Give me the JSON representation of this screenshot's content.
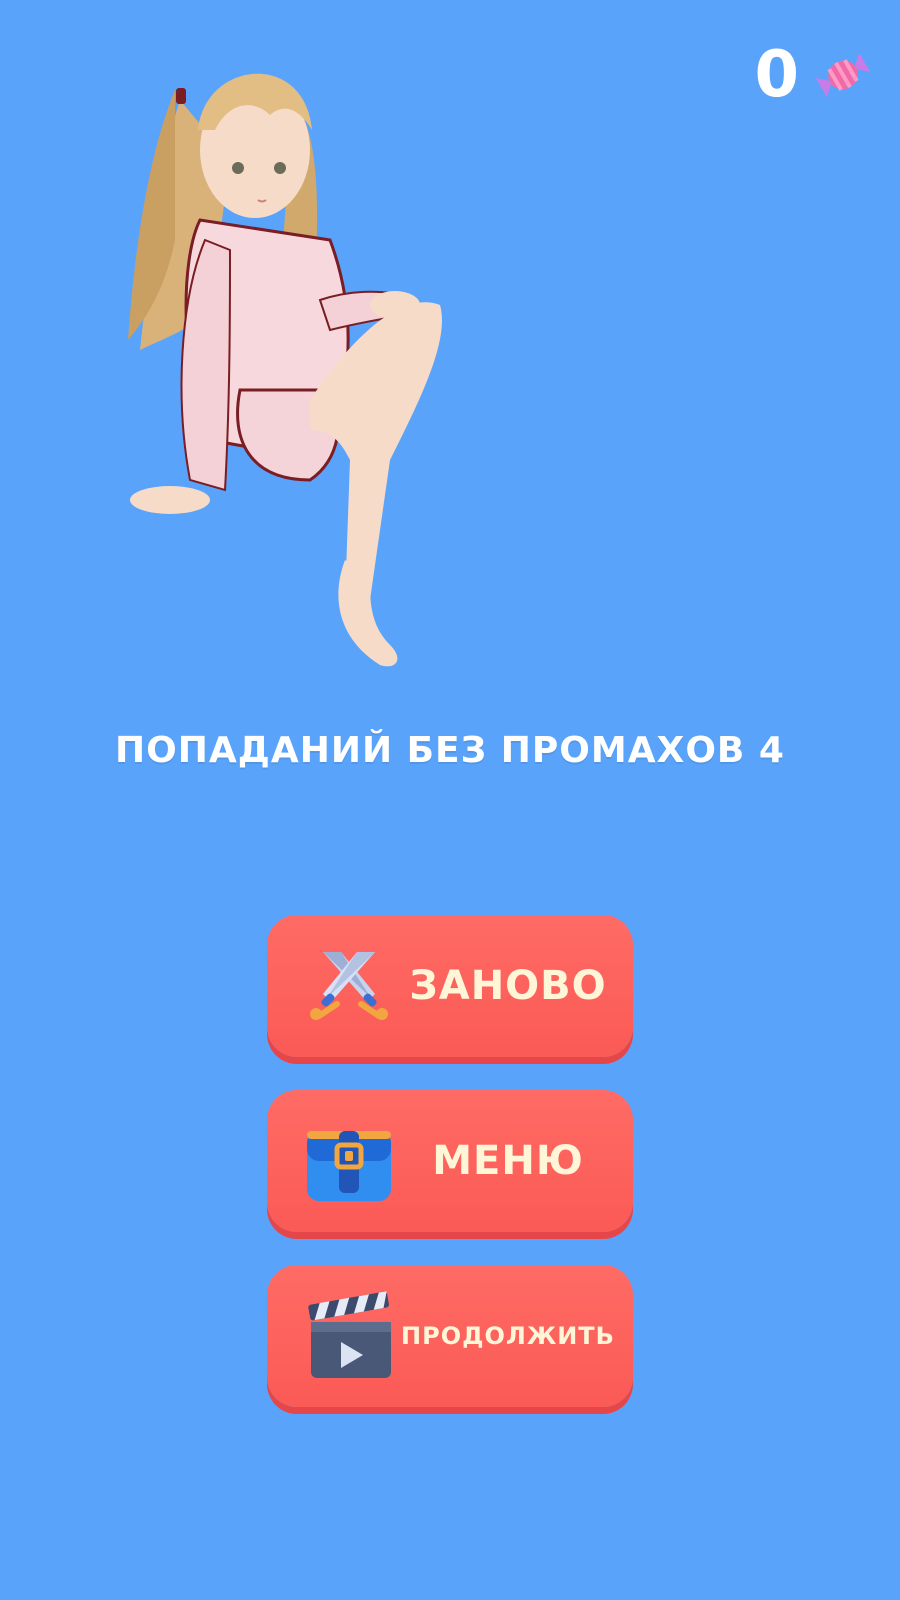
{
  "hud": {
    "score": "0",
    "currency_icon": "candy-icon"
  },
  "character": {
    "icon": "anime-girl-illustration"
  },
  "result": {
    "text": "ПОПАДАНИЙ БЕЗ ПРОМАХОВ 4"
  },
  "buttons": {
    "restart": {
      "label": "ЗАНОВО",
      "icon": "crossed-swords-icon"
    },
    "menu": {
      "label": "МЕНЮ",
      "icon": "backpack-icon"
    },
    "continue": {
      "label": "ПРОДОЛЖИТЬ",
      "icon": "clapperboard-play-icon"
    }
  },
  "colors": {
    "background": "#5aa3fb",
    "button": "#ff6b65",
    "button_shadow": "#e5464a",
    "button_text": "#fff6d8",
    "text": "#ffffff",
    "candy": "#f06aa8"
  }
}
